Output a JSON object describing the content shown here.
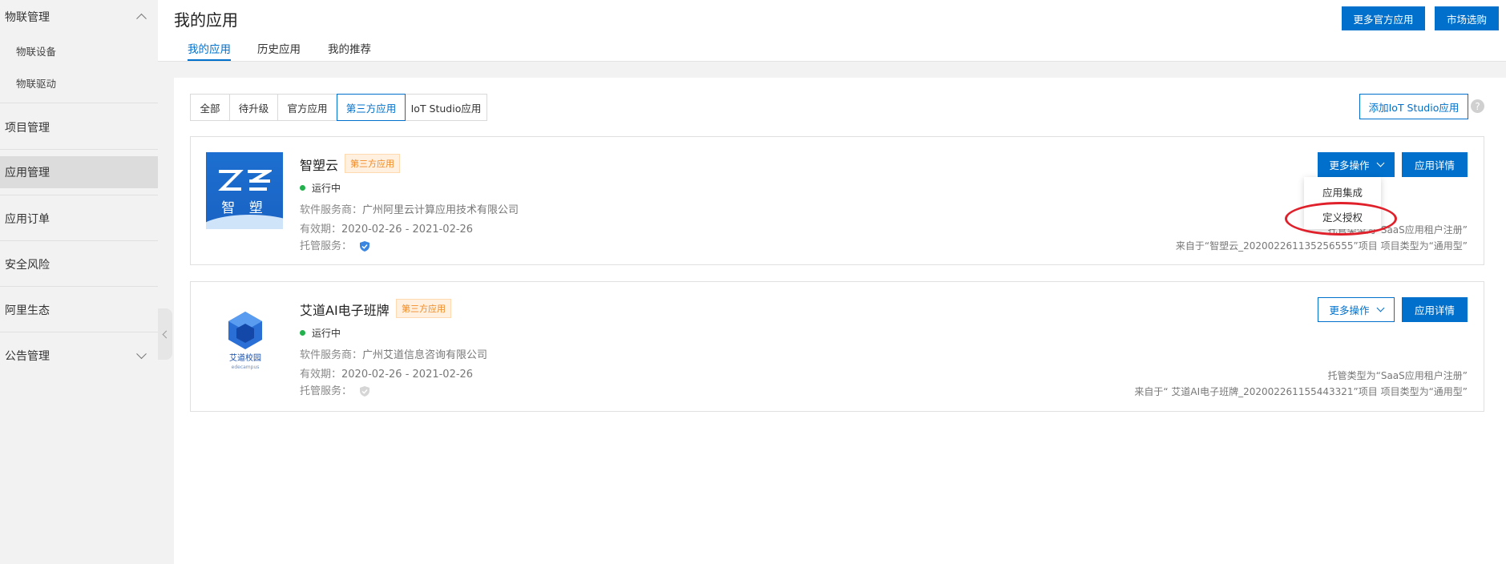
{
  "sidebar": {
    "items": [
      {
        "label": "物联管理"
      },
      {
        "label": "物联设备"
      },
      {
        "label": "物联驱动"
      },
      {
        "label": "项目管理"
      },
      {
        "label": "应用管理"
      },
      {
        "label": "应用订单"
      },
      {
        "label": "安全风险"
      },
      {
        "label": "阿里生态"
      },
      {
        "label": "公告管理"
      }
    ]
  },
  "header": {
    "title": "我的应用",
    "tabs": [
      {
        "label": "我的应用"
      },
      {
        "label": "历史应用"
      },
      {
        "label": "我的推荐"
      }
    ],
    "more_official_label": "更多官方应用",
    "market_label": "市场选购"
  },
  "filters": {
    "items": [
      {
        "label": "全部"
      },
      {
        "label": "待升级"
      },
      {
        "label": "官方应用"
      },
      {
        "label": "第三方应用"
      },
      {
        "label": "IoT Studio应用"
      }
    ],
    "add_studio_label": "添加IoT Studio应用",
    "help": "?"
  },
  "apps": [
    {
      "logo_text": "智 塑",
      "name": "智塑云",
      "badge": "第三方应用",
      "status": "运行中",
      "vendor_label": "软件服务商：",
      "vendor": "广州阿里云计算应用技术有限公司",
      "validity_label": "有效期：",
      "validity": "2020-02-26 - 2021-02-26",
      "hosting_label": "托管服务：",
      "more_label": "更多操作",
      "detail_label": "应用详情",
      "hosting_type": "托管类型为“SaaS应用租户注册”",
      "source": "来自于“智塑云_202002261135256555”项目   项目类型为“通用型”"
    },
    {
      "logo_text": "艾道校园",
      "logo_sub": "edecampus",
      "name": "艾道AI电子班牌",
      "badge": "第三方应用",
      "status": "运行中",
      "vendor_label": "软件服务商：",
      "vendor": "广州艾道信息咨询有限公司",
      "validity_label": "有效期：",
      "validity": "2020-02-26 - 2021-02-26",
      "hosting_label": "托管服务：",
      "more_label": "更多操作",
      "detail_label": "应用详情",
      "hosting_type": "托管类型为“SaaS应用租户注册”",
      "source": "来自于“ 艾道AI电子班牌_202002261155443321”项目   项目类型为“通用型”"
    }
  ],
  "dropdown": {
    "items": [
      {
        "label": "应用集成"
      },
      {
        "label": "定义授权"
      }
    ]
  },
  "colors": {
    "accent": "#0070cc",
    "badge_bg": "#fff0e0",
    "badge_text": "#f08a24",
    "running": "#22b14c",
    "annotation": "#e0202a"
  }
}
